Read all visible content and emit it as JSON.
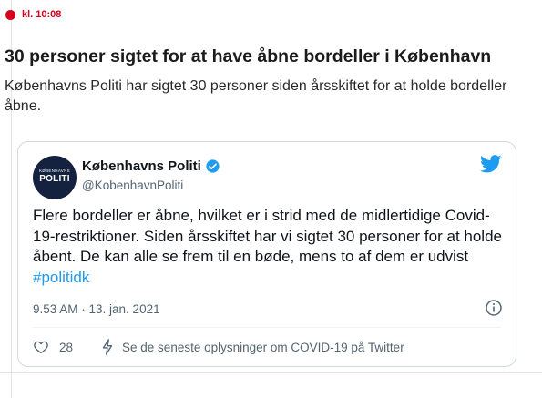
{
  "entry": {
    "time": "kl. 10:08",
    "headline": "30 personer sigtet for at have åbne bordeller i København",
    "lead": "Københavns Politi har sigtet 30 personer siden årsskiftet for at holde bordeller åbne."
  },
  "tweet": {
    "avatar_small": "KØBENHAVNS",
    "avatar_big": "POLITI",
    "author_name": "Københavns Politi",
    "handle": "@KobenhavnPoliti",
    "text": "Flere bordeller er åbne, hvilket er i strid med de midlertidige Covid-19-restriktioner. Siden årsskiftet har vi sigtet 30 personer for at holde åbent. De kan alle se frem til en bøde, mens to af dem er udvist ",
    "hashtag": "#politidk",
    "timestamp": "9.53 AM · 13. jan. 2021",
    "like_count": "28",
    "covid_link": "Se de seneste oplysninger om COVID-19 på Twitter"
  },
  "colors": {
    "accent_red": "#d6001c",
    "twitter_blue": "#1d9bf0",
    "avatar_bg": "#14223f"
  }
}
